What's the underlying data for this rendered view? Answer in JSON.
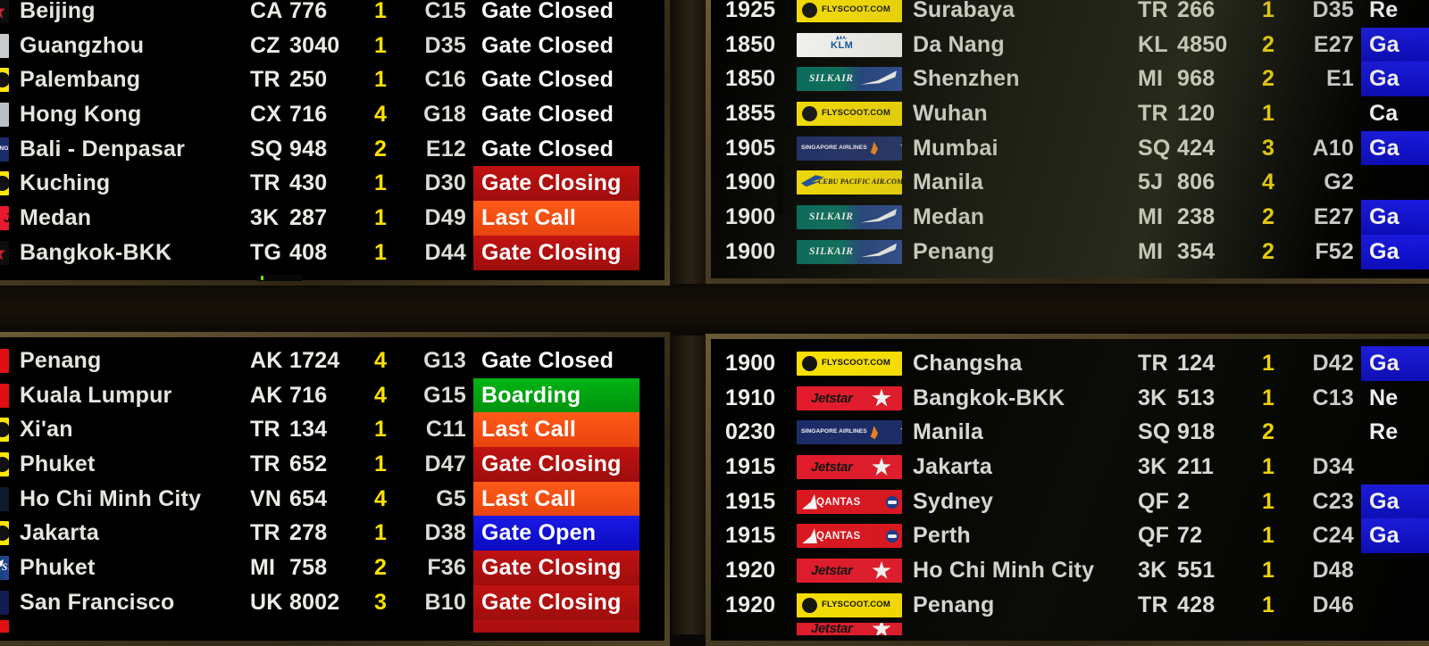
{
  "board": {
    "title": "Airport Departure Information Display",
    "status_colors": {
      "gate_closed": "#000000",
      "gate_closing": "#b50f0f",
      "last_call": "#f24b12",
      "boarding": "#00a310",
      "gate_open": "#1010d8"
    },
    "terminal_color": "#ffe000",
    "text_color": "#e9e9e4"
  },
  "panels": {
    "top_left": {
      "name": "departures-panel-top-left",
      "layout": "left",
      "rows": [
        {
          "logo": "air-china-logo",
          "destination": "Beijing",
          "airline": "CA",
          "flight": "776",
          "terminal": "1",
          "gate": "C15",
          "status": "Gate Closed",
          "status_class": "st-closed"
        },
        {
          "logo": "china-southern-logo",
          "destination": "Guangzhou",
          "airline": "CZ",
          "flight": "3040",
          "terminal": "1",
          "gate": "D35",
          "status": "Gate Closed",
          "status_class": "st-closed"
        },
        {
          "logo": "scoot-logo",
          "destination": "Palembang",
          "airline": "TR",
          "flight": "250",
          "terminal": "1",
          "gate": "C16",
          "status": "Gate Closed",
          "status_class": "st-closed"
        },
        {
          "logo": "cathay-pacific-logo",
          "destination": "Hong Kong",
          "airline": "CX",
          "flight": "716",
          "terminal": "4",
          "gate": "G18",
          "status": "Gate Closed",
          "status_class": "st-closed"
        },
        {
          "logo": "singapore-airlines-logo",
          "destination": "Bali - Denpasar",
          "airline": "SQ",
          "flight": "948",
          "terminal": "2",
          "gate": "E12",
          "status": "Gate Closed",
          "status_class": "st-closed"
        },
        {
          "logo": "scoot-logo",
          "destination": "Kuching",
          "airline": "TR",
          "flight": "430",
          "terminal": "1",
          "gate": "D30",
          "status": "Gate Closing",
          "status_class": "st-closing"
        },
        {
          "logo": "jetstar-logo",
          "destination": "Medan",
          "airline": "3K",
          "flight": "287",
          "terminal": "1",
          "gate": "D49",
          "status": "Last Call",
          "status_class": "st-lastcall"
        },
        {
          "logo": "thai-airways-logo",
          "destination": "Bangkok-BKK",
          "airline": "TG",
          "flight": "408",
          "terminal": "1",
          "gate": "D44",
          "status": "Gate Closing",
          "status_class": "st-closing"
        }
      ]
    },
    "top_right": {
      "name": "departures-panel-top-right",
      "layout": "right",
      "rows": [
        {
          "time": "1925",
          "logo": "scoot-logo",
          "destination": "Surabaya",
          "airline": "TR",
          "flight": "266",
          "terminal": "1",
          "gate": "D35",
          "status": "Re",
          "status_class": "st-none"
        },
        {
          "time": "1850",
          "logo": "klm-logo",
          "destination": "Da Nang",
          "airline": "KL",
          "flight": "4850",
          "terminal": "2",
          "gate": "E27",
          "status": "Ga",
          "status_class": "st-open"
        },
        {
          "time": "1850",
          "logo": "silkair-logo",
          "destination": "Shenzhen",
          "airline": "MI",
          "flight": "968",
          "terminal": "2",
          "gate": "E1",
          "status": "Ga",
          "status_class": "st-open"
        },
        {
          "time": "1855",
          "logo": "scoot-logo",
          "destination": "Wuhan",
          "airline": "TR",
          "flight": "120",
          "terminal": "1",
          "gate": "",
          "status": "Ca",
          "status_class": "st-none"
        },
        {
          "time": "1905",
          "logo": "singapore-airlines-logo",
          "destination": "Mumbai",
          "airline": "SQ",
          "flight": "424",
          "terminal": "3",
          "gate": "A10",
          "status": "Ga",
          "status_class": "st-open"
        },
        {
          "time": "1900",
          "logo": "cebu-pacific-logo",
          "destination": "Manila",
          "airline": "5J",
          "flight": "806",
          "terminal": "4",
          "gate": "G2",
          "status": "",
          "status_class": "st-none"
        },
        {
          "time": "1900",
          "logo": "silkair-logo",
          "destination": "Medan",
          "airline": "MI",
          "flight": "238",
          "terminal": "2",
          "gate": "E27",
          "status": "Ga",
          "status_class": "st-open"
        },
        {
          "time": "1900",
          "logo": "silkair-logo",
          "destination": "Penang",
          "airline": "MI",
          "flight": "354",
          "terminal": "2",
          "gate": "F52",
          "status": "Ga",
          "status_class": "st-open"
        }
      ]
    },
    "bottom_left": {
      "name": "departures-panel-bottom-left",
      "layout": "left",
      "rows": [
        {
          "logo": "airasia-logo",
          "destination": "Penang",
          "airline": "AK",
          "flight": "1724",
          "terminal": "4",
          "gate": "G13",
          "status": "Gate Closed",
          "status_class": "st-closed"
        },
        {
          "logo": "airasia-logo",
          "destination": "Kuala Lumpur",
          "airline": "AK",
          "flight": "716",
          "terminal": "4",
          "gate": "G15",
          "status": "Boarding",
          "status_class": "st-boarding"
        },
        {
          "logo": "scoot-logo",
          "destination": "Xi'an",
          "airline": "TR",
          "flight": "134",
          "terminal": "1",
          "gate": "C11",
          "status": "Last Call",
          "status_class": "st-lastcall"
        },
        {
          "logo": "scoot-logo",
          "destination": "Phuket",
          "airline": "TR",
          "flight": "652",
          "terminal": "1",
          "gate": "D47",
          "status": "Gate Closing",
          "status_class": "st-closing"
        },
        {
          "logo": "vietnam-airlines-logo",
          "destination": "Ho Chi Minh City",
          "airline": "VN",
          "flight": "654",
          "terminal": "4",
          "gate": "G5",
          "status": "Last Call",
          "status_class": "st-lastcall"
        },
        {
          "logo": "scoot-logo",
          "destination": "Jakarta",
          "airline": "TR",
          "flight": "278",
          "terminal": "1",
          "gate": "D38",
          "status": "Gate Open",
          "status_class": "st-open"
        },
        {
          "logo": "silkair-logo",
          "destination": "Phuket",
          "airline": "MI",
          "flight": "758",
          "terminal": "2",
          "gate": "F36",
          "status": "Gate Closing",
          "status_class": "st-closing"
        },
        {
          "logo": "vistara-logo",
          "destination": "San Francisco",
          "airline": "UK",
          "flight": "8002",
          "terminal": "3",
          "gate": "B10",
          "status": "Gate Closing",
          "status_class": "st-closing"
        },
        {
          "logo": "partial-logo",
          "destination": "",
          "airline": "",
          "flight": "",
          "terminal": "",
          "gate": "",
          "status": "",
          "status_class": "st-closing",
          "partial": true
        }
      ]
    },
    "bottom_right": {
      "name": "departures-panel-bottom-right",
      "layout": "right",
      "rows": [
        {
          "time": "1900",
          "logo": "scoot-logo",
          "destination": "Changsha",
          "airline": "TR",
          "flight": "124",
          "terminal": "1",
          "gate": "D42",
          "status": "Ga",
          "status_class": "st-open"
        },
        {
          "time": "1910",
          "logo": "jetstar-logo",
          "destination": "Bangkok-BKK",
          "airline": "3K",
          "flight": "513",
          "terminal": "1",
          "gate": "C13",
          "status": "Ne",
          "status_class": "st-none"
        },
        {
          "time": "0230",
          "logo": "singapore-airlines-logo",
          "destination": "Manila",
          "airline": "SQ",
          "flight": "918",
          "terminal": "2",
          "gate": "",
          "status": "Re",
          "status_class": "st-none"
        },
        {
          "time": "1915",
          "logo": "jetstar-logo",
          "destination": "Jakarta",
          "airline": "3K",
          "flight": "211",
          "terminal": "1",
          "gate": "D34",
          "status": "",
          "status_class": "st-none"
        },
        {
          "time": "1915",
          "logo": "qantas-logo",
          "destination": "Sydney",
          "airline": "QF",
          "flight": "2",
          "terminal": "1",
          "gate": "C23",
          "status": "Ga",
          "status_class": "st-open"
        },
        {
          "time": "1915",
          "logo": "qantas-logo",
          "destination": "Perth",
          "airline": "QF",
          "flight": "72",
          "terminal": "1",
          "gate": "C24",
          "status": "Ga",
          "status_class": "st-open"
        },
        {
          "time": "1920",
          "logo": "jetstar-logo",
          "destination": "Ho Chi Minh City",
          "airline": "3K",
          "flight": "551",
          "terminal": "1",
          "gate": "D48",
          "status": "",
          "status_class": "st-none"
        },
        {
          "time": "1920",
          "logo": "scoot-logo",
          "destination": "Penang",
          "airline": "TR",
          "flight": "428",
          "terminal": "1",
          "gate": "D46",
          "status": "",
          "status_class": "st-none"
        },
        {
          "time": "",
          "logo": "jetstar-logo",
          "destination": "",
          "airline": "",
          "flight": "",
          "terminal": "",
          "gate": "",
          "status": "",
          "status_class": "st-none",
          "partial": true
        }
      ]
    }
  }
}
